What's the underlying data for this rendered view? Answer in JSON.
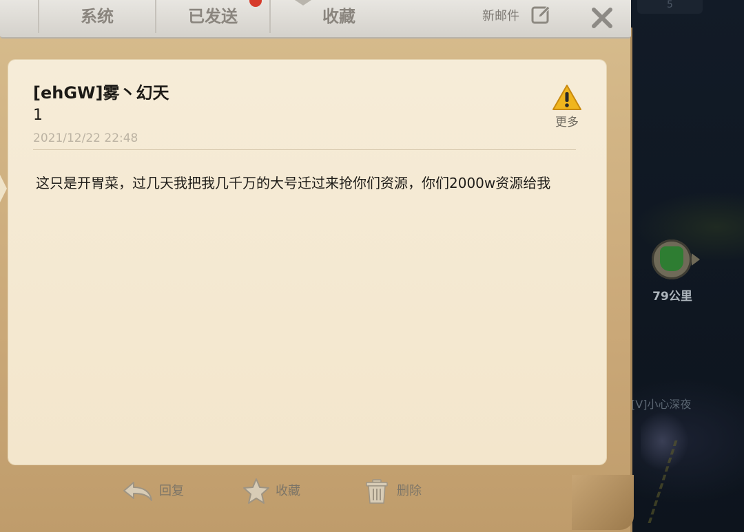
{
  "tabs": {
    "system": "系统",
    "sent": "已发送",
    "favorites": "收藏"
  },
  "header": {
    "new_mail_label": "新邮件",
    "new_mail_icon": "edit-icon",
    "close_icon": "close-icon"
  },
  "mail": {
    "sender": "[ehGW]雾丶幻天",
    "subject": "1",
    "timestamp": "2021/12/22 22:48",
    "body": "这只是开胃菜，过几天我把我几千万的大号迁过来抢你们资源，你们2000w资源给我",
    "more_label": "更多",
    "more_icon": "warning-icon"
  },
  "actions": {
    "reply_label": "回复",
    "favorite_label": "收藏",
    "delete_label": "删除"
  },
  "map": {
    "badge": "5",
    "distance": "79公里",
    "player_name": "[V]小心深夜"
  },
  "colors": {
    "parchment": "#caa878",
    "card": "#f6ecd8",
    "warning": "#f0b51e"
  }
}
